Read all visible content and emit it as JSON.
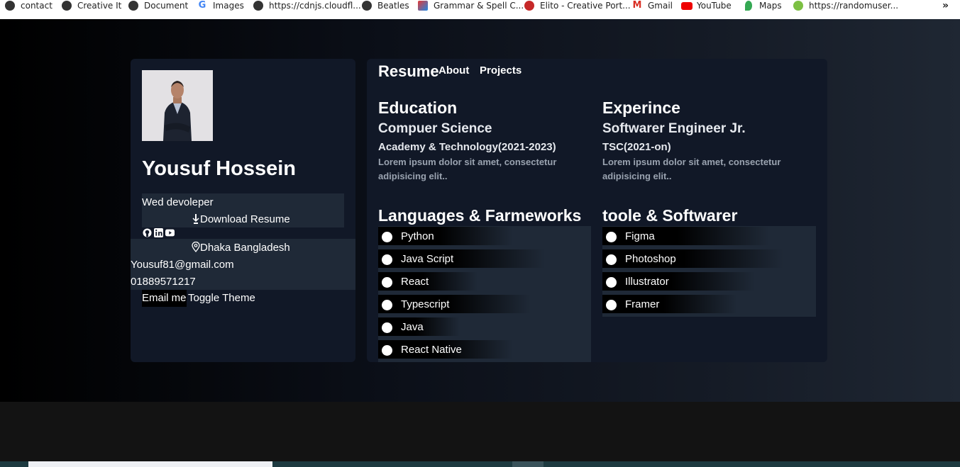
{
  "bookmarks": [
    {
      "label": "contact",
      "icon": "globe-icon"
    },
    {
      "label": "Creative It",
      "icon": "globe-icon"
    },
    {
      "label": "Document",
      "icon": "globe-icon"
    },
    {
      "label": "Images",
      "icon": "google-icon"
    },
    {
      "label": "https://cdnjs.cloudfl...",
      "icon": "globe-icon"
    },
    {
      "label": "Beatles",
      "icon": "globe-icon"
    },
    {
      "label": "Grammar & Spell C...",
      "icon": "grammar-icon"
    },
    {
      "label": "Elito - Creative Port...",
      "icon": "elito-icon"
    },
    {
      "label": "Gmail",
      "icon": "gmail-icon"
    },
    {
      "label": "YouTube",
      "icon": "youtube-icon"
    },
    {
      "label": "Maps",
      "icon": "maps-icon"
    },
    {
      "label": "https://randomuser...",
      "icon": "randomuser-icon"
    }
  ],
  "bookmarks_more": "»",
  "profile": {
    "name": "Yousuf Hossein",
    "role": "Wed devoleper",
    "download_label": "Download Resume",
    "location": "Dhaka Bangladesh",
    "email": "Yousuf81@gmail.com",
    "phone": "01889571217",
    "email_button": "Email me",
    "theme_button": "Toggle Theme"
  },
  "tabs": {
    "resume": "Resume",
    "about": "About",
    "projects": "Projects"
  },
  "education": {
    "heading": "Education",
    "title": "Compuer Science",
    "institution": "Academy & Technology(2021-2023)",
    "description": "Lorem ipsum dolor sit amet, consectetur adipisicing elit.."
  },
  "experience": {
    "heading": "Experince",
    "title": "Softwarer Engineer Jr.",
    "company": "TSC(2021-on)",
    "description": "Lorem ipsum dolor sit amet, consectetur adipisicing elit.."
  },
  "languages": {
    "heading": "Languages & Farmeworks",
    "items": [
      "Python",
      "Java Script",
      "React",
      "Typescript",
      "Java",
      "React Native"
    ]
  },
  "tools": {
    "heading": "toole & Softwarer",
    "items": [
      "Figma",
      "Photoshop",
      "Illustrator",
      "Framer"
    ]
  }
}
